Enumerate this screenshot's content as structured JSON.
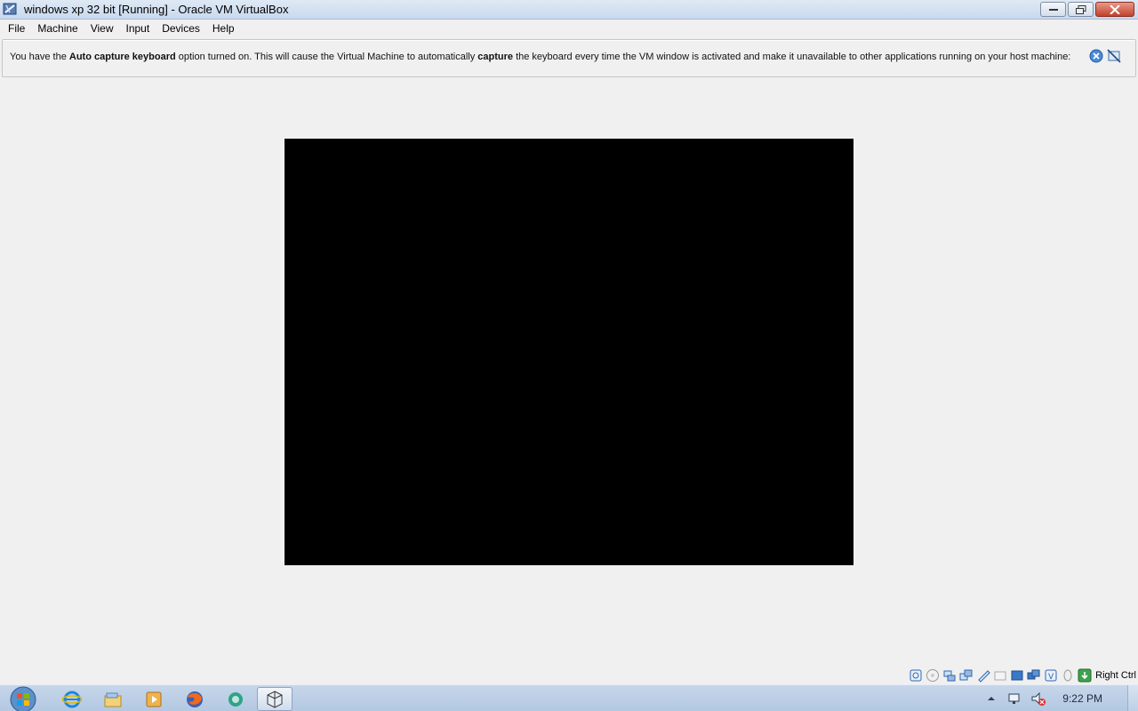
{
  "window": {
    "title": "windows xp 32 bit [Running] - Oracle VM VirtualBox"
  },
  "menu": {
    "items": [
      "File",
      "Machine",
      "View",
      "Input",
      "Devices",
      "Help"
    ]
  },
  "notification": {
    "part1": "You have the ",
    "bold1": "Auto capture keyboard",
    "part2": " option turned on. This will cause the Virtual Machine to automatically ",
    "bold2": "capture",
    "part3": " the keyboard every time the VM window is activated and make it unavailable to other applications running on your host machine:"
  },
  "statusbar": {
    "host_key": "Right Ctrl",
    "icons": [
      "hard-disk-icon",
      "optical-drive-icon",
      "usb-icon",
      "network-icon",
      "shared-folders-icon",
      "display-icon",
      "video-capture-icon",
      "screen-icon",
      "cpu-virtualization-icon",
      "mouse-integration-icon",
      "keyboard-capture-icon"
    ]
  },
  "taskbar": {
    "apps": [
      "internet-explorer-icon",
      "file-explorer-icon",
      "media-player-icon",
      "firefox-icon",
      "messenger-icon",
      "virtualbox-icon"
    ],
    "clock": "9:22 PM"
  },
  "colors": {
    "vm_screen": "#000000",
    "background": "#f0f0f0",
    "taskbar": "#b3c8e1"
  }
}
